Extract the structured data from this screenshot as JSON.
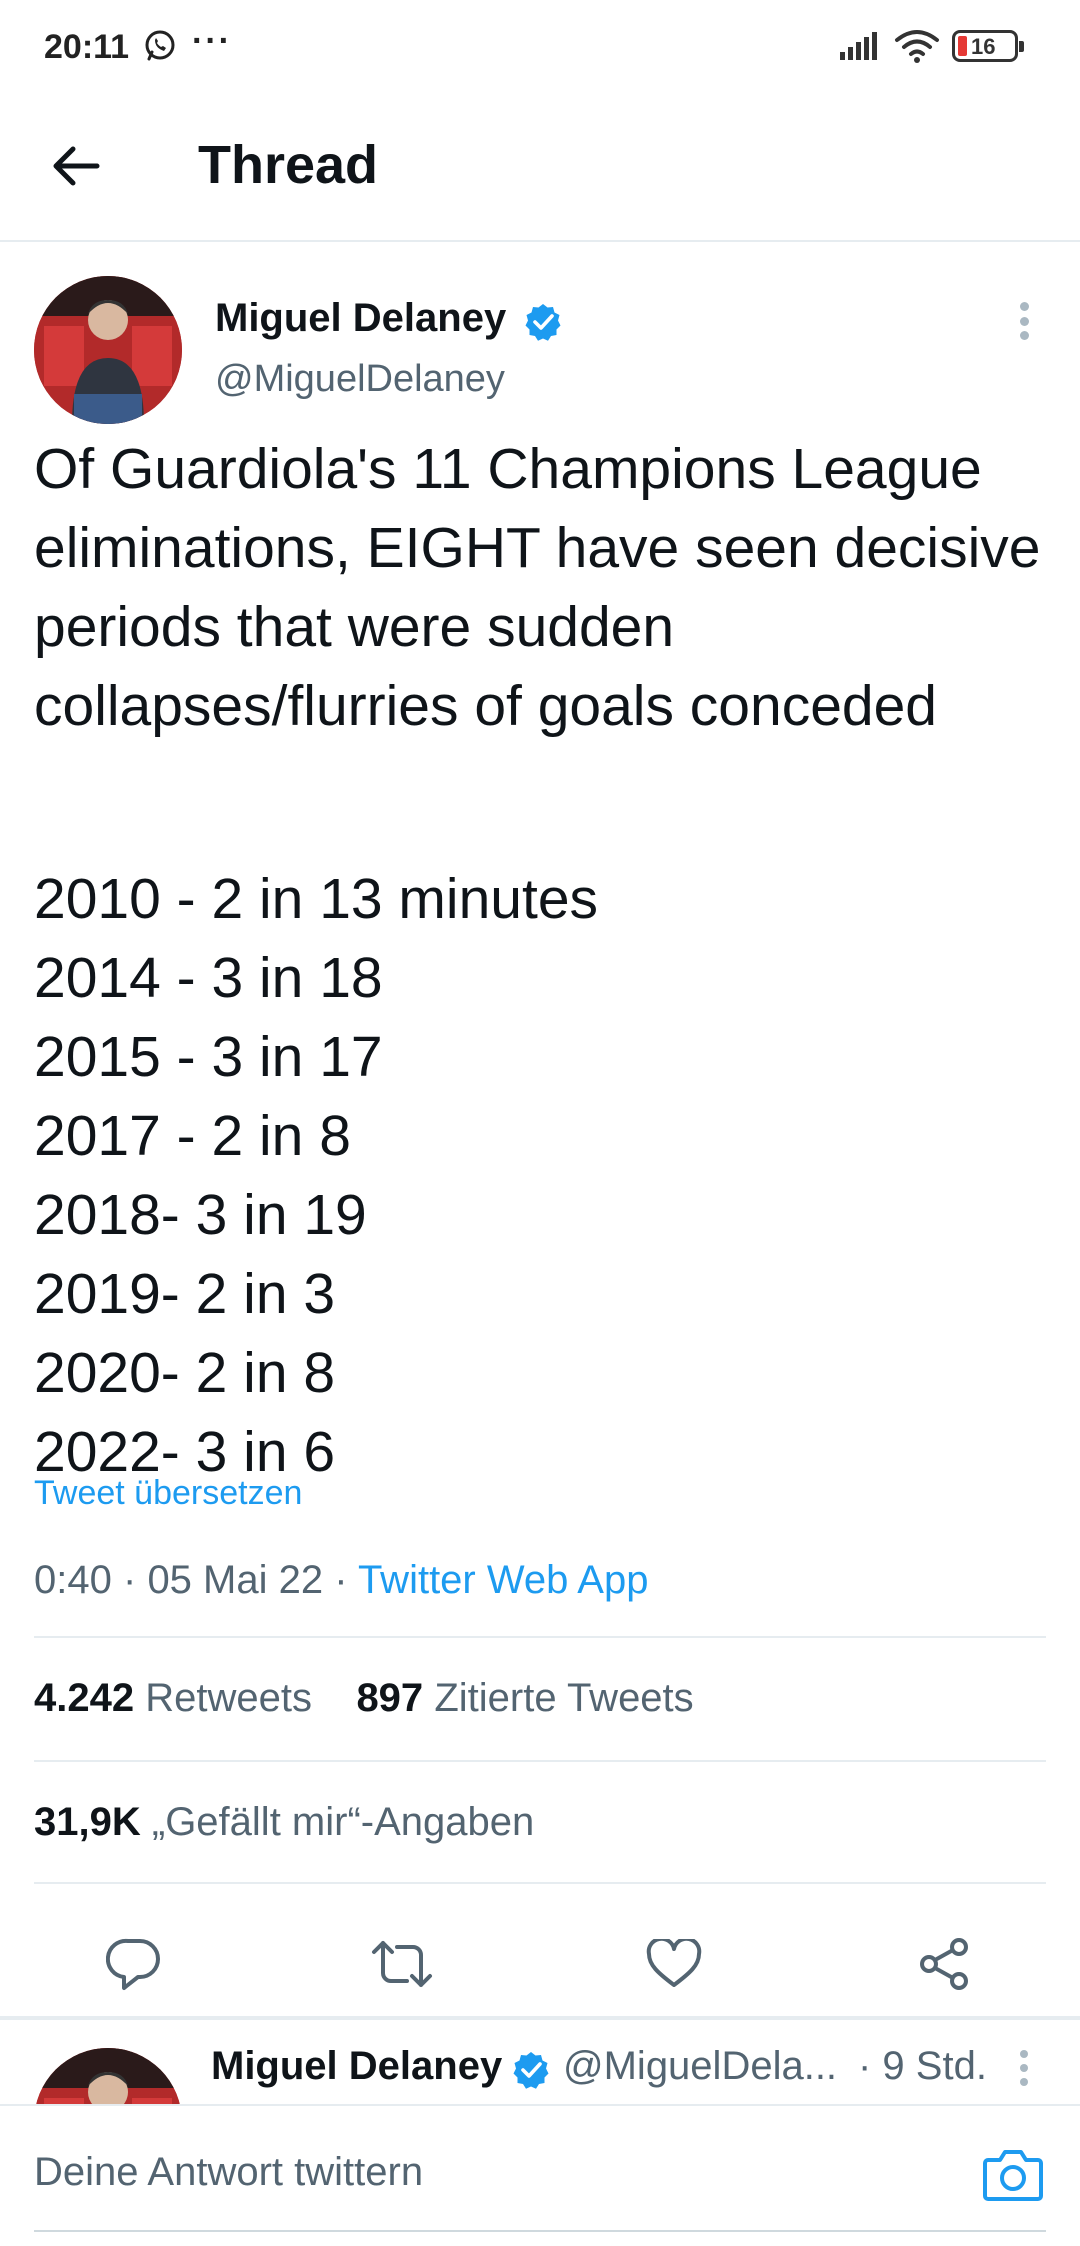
{
  "status_bar": {
    "time": "20:11",
    "more_indicator": "···",
    "battery_level": "16",
    "icons": [
      "whatsapp-icon",
      "signal-icon",
      "wifi-icon",
      "battery-icon"
    ]
  },
  "header": {
    "back_icon": "arrow-left-icon",
    "title": "Thread"
  },
  "tweet": {
    "author_name": "Miguel Delaney",
    "author_handle": "@MiguelDelaney",
    "verified": true,
    "text": "Of Guardiola's 11 Champions League eliminations, EIGHT have seen decisive periods that were sudden collapses/flurries of goals conceded",
    "stats_lines": [
      "2010 - 2 in 13 minutes",
      "2014 - 3 in 18",
      "2015 - 3 in 17",
      "2017 - 2 in 8",
      "2018- 3 in 19",
      "2019- 2 in 3",
      "2020- 2 in 8",
      "2022- 3 in 6"
    ],
    "translate_label": "Tweet übersetzen",
    "time": "0:40",
    "separator": "·",
    "date": "05 Mai 22",
    "source": "Twitter Web App",
    "retweets_count": "4.242",
    "retweets_label": "Retweets",
    "quotes_count": "897",
    "quotes_label": "Zitierte Tweets",
    "likes_count": "31,9K",
    "likes_label": "„Gefällt mir“-Angaben",
    "accent_color": "#1d9bf0"
  },
  "actions": {
    "icons": [
      "reply-icon",
      "retweet-icon",
      "like-icon",
      "share-icon"
    ]
  },
  "reply": {
    "author_name": "Miguel Delaney",
    "author_handle": "@MiguelDela...",
    "time": "· 9 Std."
  },
  "compose": {
    "placeholder": "Deine Antwort twittern",
    "camera_icon": "camera-icon"
  }
}
